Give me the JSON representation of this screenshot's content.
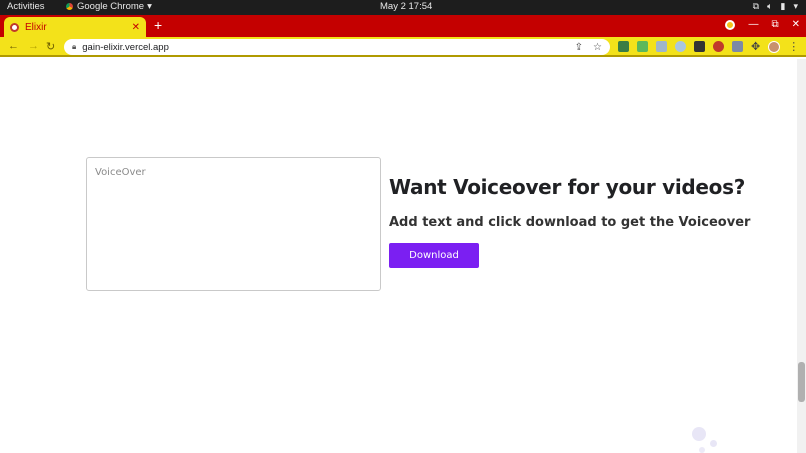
{
  "system_bar": {
    "activities": "Activities",
    "app_name": "Google Chrome",
    "clock": "May 2  17:54"
  },
  "browser": {
    "tab_title": "Elixir",
    "url": "gain-elixir.vercel.app",
    "theme_colors": {
      "tabstrip": "#c40000",
      "toolbar": "#f3e21a"
    }
  },
  "page": {
    "textarea_placeholder": "VoiceOver",
    "heading": "Want Voiceover for your videos?",
    "subheading": "Add text and click download to get the Voiceover",
    "download_label": "Download",
    "accent_color": "#7b1ff2"
  }
}
